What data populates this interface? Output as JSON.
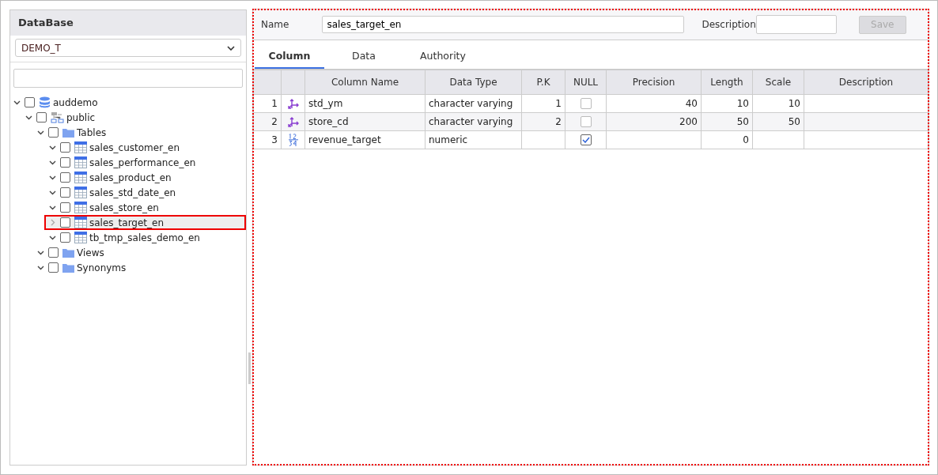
{
  "sidebar": {
    "title": "DataBase",
    "database_select": "DEMO_T",
    "tree": [
      {
        "label": "auddemo",
        "kind": "database",
        "expanded": true,
        "checked": false,
        "selected": false,
        "children": [
          {
            "label": "public",
            "kind": "schema",
            "expanded": true,
            "checked": false,
            "selected": false,
            "children": [
              {
                "label": "Tables",
                "kind": "folder",
                "expanded": true,
                "checked": false,
                "selected": false,
                "children": [
                  {
                    "label": "sales_customer_en",
                    "kind": "table",
                    "expanded": true,
                    "checked": false,
                    "selected": false
                  },
                  {
                    "label": "sales_performance_en",
                    "kind": "table",
                    "expanded": true,
                    "checked": false,
                    "selected": false
                  },
                  {
                    "label": "sales_product_en",
                    "kind": "table",
                    "expanded": true,
                    "checked": false,
                    "selected": false
                  },
                  {
                    "label": "sales_std_date_en",
                    "kind": "table",
                    "expanded": true,
                    "checked": false,
                    "selected": false
                  },
                  {
                    "label": "sales_store_en",
                    "kind": "table",
                    "expanded": true,
                    "checked": false,
                    "selected": false
                  },
                  {
                    "label": "sales_target_en",
                    "kind": "table",
                    "expanded": false,
                    "checked": false,
                    "selected": true
                  },
                  {
                    "label": "tb_tmp_sales_demo_en",
                    "kind": "table",
                    "expanded": true,
                    "checked": false,
                    "selected": false
                  }
                ]
              },
              {
                "label": "Views",
                "kind": "folder",
                "expanded": true,
                "checked": false,
                "selected": false
              },
              {
                "label": "Synonyms",
                "kind": "folder",
                "expanded": true,
                "checked": false,
                "selected": false
              }
            ]
          }
        ]
      }
    ]
  },
  "form": {
    "name_label": "Name",
    "name_value": "sales_target_en",
    "description_label": "Description",
    "save_button": {
      "label": "Save",
      "disabled": true
    }
  },
  "tabs": [
    {
      "label": "Column",
      "selected": true
    },
    {
      "label": "Data",
      "selected": false
    },
    {
      "label": "Authority",
      "selected": false
    }
  ],
  "table": {
    "columns": [
      "Column Name",
      "Data Type",
      "P.K",
      "NULL",
      "Precision",
      "Length",
      "Scale",
      "Description"
    ],
    "rows": [
      {
        "index": "1",
        "kind": "key",
        "name": "std_ym",
        "type": "character varying",
        "pk": "1",
        "null": false,
        "precision": "40",
        "length": "10",
        "scale": "10"
      },
      {
        "index": "2",
        "kind": "key",
        "name": "store_cd",
        "type": "character varying",
        "pk": "2",
        "null": false,
        "precision": "200",
        "length": "50",
        "scale": "50"
      },
      {
        "index": "3",
        "kind": "number",
        "name": "revenue_target",
        "type": "numeric",
        "pk": "",
        "null": true,
        "precision": "",
        "length": "0",
        "scale": ""
      }
    ]
  }
}
